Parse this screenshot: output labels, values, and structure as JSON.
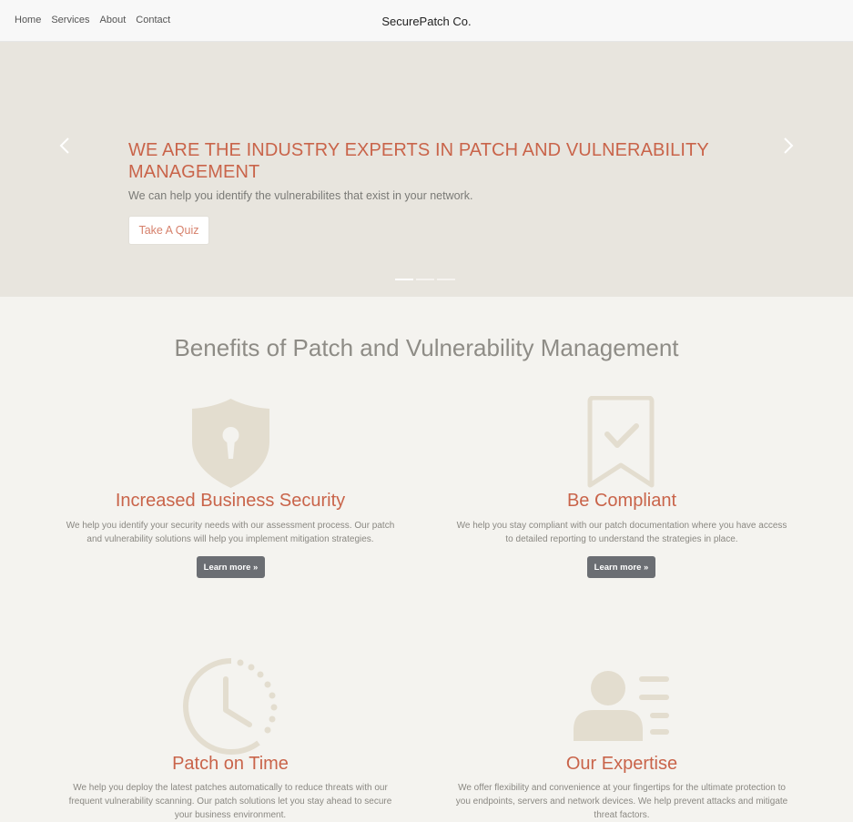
{
  "nav": {
    "links": [
      "Home",
      "Services",
      "About",
      "Contact"
    ],
    "brand": "SecurePatch Co."
  },
  "hero": {
    "title": "WE ARE THE INDUSTRY EXPERTS IN PATCH AND VULNERABILITY MANAGEMENT",
    "subtitle": "We can help you identify the vulnerabilites that exist in your network.",
    "button_label": "Take A Quiz",
    "prev_icon": "chevron-left-icon",
    "next_icon": "chevron-right-icon",
    "slide_count": 3,
    "active_slide": 1
  },
  "section": {
    "title": "Benefits of Patch and Vulnerability Management"
  },
  "features": [
    {
      "icon": "shield-lock-icon",
      "title": "Increased Business Security",
      "description": "We help you identify your security needs with our assessment process. Our patch and vulnerability solutions will help you implement mitigation strategies.",
      "button_label": "Learn more »"
    },
    {
      "icon": "bookmark-check-icon",
      "title": "Be Compliant",
      "description": "We help you stay compliant with our patch documentation where you have access to detailed reporting to understand the strategies in place.",
      "button_label": "Learn more »"
    },
    {
      "icon": "clock-icon",
      "title": "Patch on Time",
      "description": "We help you deploy the latest patches automatically to reduce threats with our frequent vulnerability scanning. Our patch solutions let you stay ahead to secure your business environment."
    },
    {
      "icon": "user-profile-icon",
      "title": "Our Expertise",
      "description": "We offer flexibility and convenience at your fingertips for the ultimate protection to you endpoints, servers and network devices. We help prevent attacks and mitigate threat factors."
    }
  ],
  "colors": {
    "accent": "#c9644a",
    "icon": "#e3ddcf",
    "hero_bg": "#e8e5de",
    "page_bg": "#f4f3ef",
    "button_dark": "#6b6e73"
  }
}
